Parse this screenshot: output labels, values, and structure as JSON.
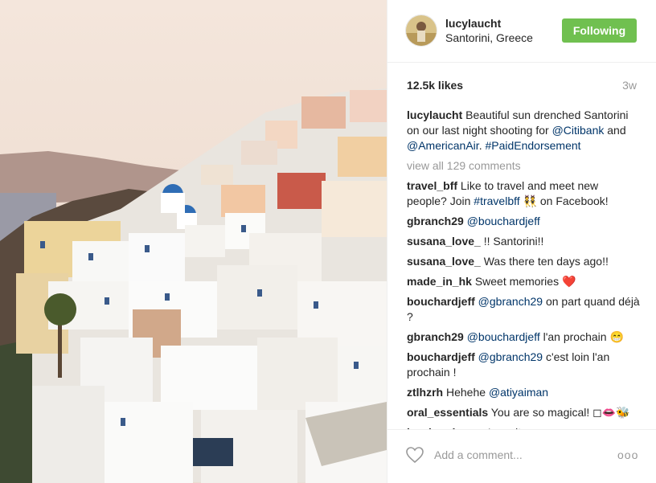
{
  "post": {
    "username": "lucylaucht",
    "location": "Santorini, Greece",
    "follow_label": "Following",
    "likes": "12.5k likes",
    "age": "3w",
    "caption": {
      "user": "lucylaucht",
      "text1": " Beautiful sun drenched Santorini on our last night shooting for ",
      "mention1": "@Citibank",
      "text2": " and ",
      "mention2": "@AmericanAir",
      "text3": ". ",
      "hashtag": "#PaidEndorsement"
    },
    "view_all": "view all 129 comments",
    "add_comment_placeholder": "Add a comment...",
    "more_label": "ooo"
  },
  "comments": [
    {
      "user": "travel_bff",
      "t1": " Like to travel and meet new people? Join ",
      "link": "#travelbff",
      "t2": " 👯 on Facebook!"
    },
    {
      "user": "gbranch29",
      "t1": " ",
      "link": "@bouchardjeff",
      "t2": ""
    },
    {
      "user": "susana_love_",
      "t1": " !! Santorini!!",
      "link": "",
      "t2": ""
    },
    {
      "user": "susana_love_",
      "t1": " Was there ten days ago!!",
      "link": "",
      "t2": ""
    },
    {
      "user": "made_in_hk",
      "t1": " Sweet memories ❤️",
      "link": "",
      "t2": ""
    },
    {
      "user": "bouchardjeff",
      "t1": " ",
      "link": "@gbranch29",
      "t2": " on part quand déjà ?"
    },
    {
      "user": "gbranch29",
      "t1": " ",
      "link": "@bouchardjeff",
      "t2": " l'an prochain 😁"
    },
    {
      "user": "bouchardjeff",
      "t1": " ",
      "link": "@gbranch29",
      "t2": " c'est loin l'an prochain !"
    },
    {
      "user": "ztlhzrh",
      "t1": " Hehehe ",
      "link": "@atiyaiman",
      "t2": ""
    },
    {
      "user": "oral_essentials",
      "t1": " You are so magical! ◻👄🐝",
      "link": "",
      "t2": ""
    },
    {
      "user": "hey.handsome",
      "t1": " Love it",
      "link": "",
      "t2": ""
    }
  ]
}
